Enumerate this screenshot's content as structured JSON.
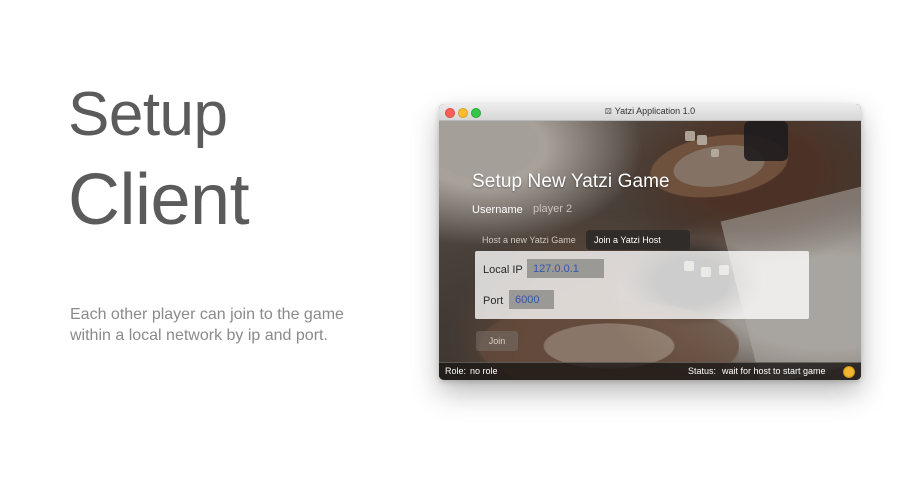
{
  "hero": {
    "title_line1": "Setup",
    "title_line2": "Client",
    "description_line1": "Each other player can join to the game",
    "description_line2": "within a local network by ip and port."
  },
  "window": {
    "title": "Yatzi Application 1.0",
    "app_icon": "dice-icon"
  },
  "form": {
    "heading": "Setup New Yatzi Game",
    "username_label": "Username",
    "username_value": "player 2",
    "tabs": [
      {
        "label": "Host a new Yatzi Game",
        "active": false
      },
      {
        "label": "Join a Yatzi Host",
        "active": true
      }
    ],
    "local_ip_label": "Local IP",
    "local_ip_value": "127.0.0.1",
    "port_label": "Port",
    "port_value": "6000",
    "join_label": "Join"
  },
  "statusbar": {
    "role_label": "Role:",
    "role_value": "no role",
    "status_label": "Status:",
    "status_value": "wait for host to start game",
    "status_color": "#f2b632"
  },
  "colors": {
    "hero_text": "#5b5b5b",
    "accent_value": "#2f58a8"
  }
}
